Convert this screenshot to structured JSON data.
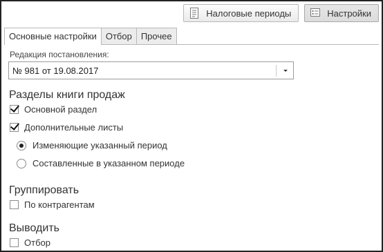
{
  "toolbar": {
    "tax_periods_label": "Налоговые периоды",
    "settings_label": "Настройки"
  },
  "tabs": [
    {
      "label": "Основные настройки",
      "active": true
    },
    {
      "label": "Отбор",
      "active": false
    },
    {
      "label": "Прочее",
      "active": false
    }
  ],
  "form": {
    "edition_label": "Редакция постановления:",
    "edition_value": "№ 981 от 19.08.2017"
  },
  "sections": {
    "book_title": "Разделы книги продаж",
    "main_section_label": "Основной раздел",
    "main_section_checked": true,
    "additional_sheets_label": "Дополнительные листы",
    "additional_sheets_checked": true,
    "radio_changing_label": "Изменяющие указанный период",
    "radio_changing_checked": true,
    "radio_composed_label": "Составленные в указанном периоде",
    "radio_composed_checked": false,
    "group_title": "Группировать",
    "by_contractors_label": "По контрагентам",
    "by_contractors_checked": false,
    "output_title": "Выводить",
    "filter_label": "Отбор",
    "filter_checked": false
  }
}
